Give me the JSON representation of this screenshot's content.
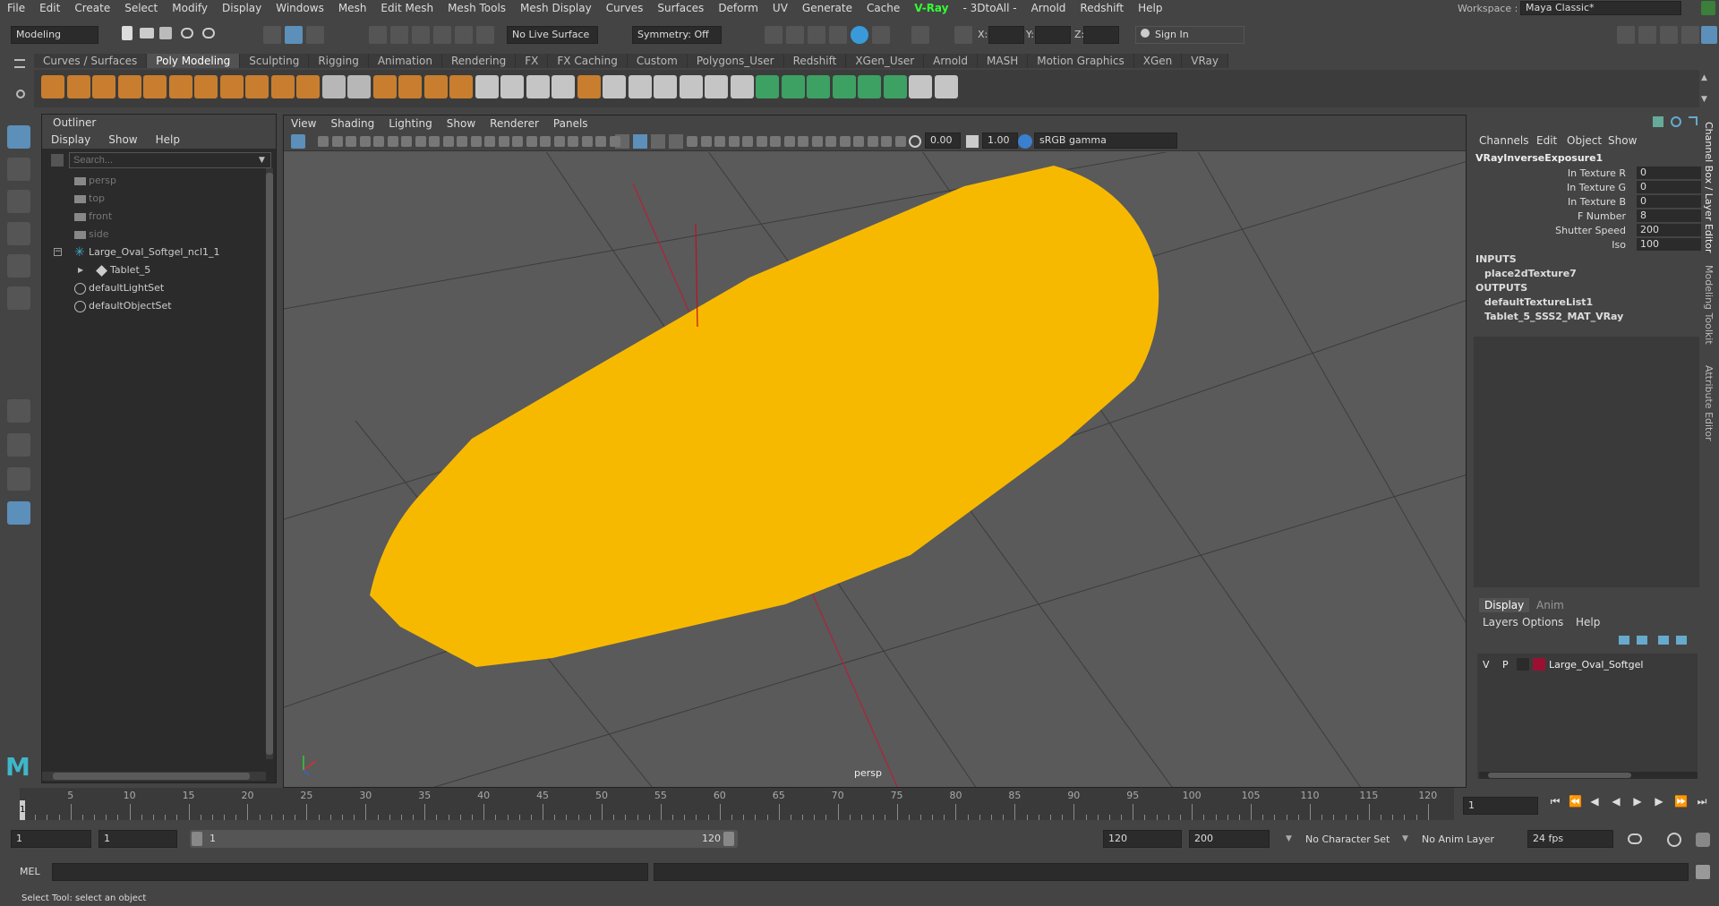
{
  "menubar": {
    "items": [
      "File",
      "Edit",
      "Create",
      "Select",
      "Modify",
      "Display",
      "Windows",
      "Mesh",
      "Edit Mesh",
      "Mesh Tools",
      "Mesh Display",
      "Curves",
      "Surfaces",
      "Deform",
      "UV",
      "Generate",
      "Cache",
      "V-Ray",
      "- 3DtoAll -",
      "Arnold",
      "Redshift",
      "Help"
    ],
    "workspace_label": "Workspace :",
    "workspace_value": "Maya Classic*"
  },
  "statusline": {
    "mode": "Modeling",
    "live_surface": "No Live Surface",
    "symmetry": "Symmetry: Off",
    "x_label": "X:",
    "y_label": "Y:",
    "z_label": "Z:",
    "sign_in": "Sign In"
  },
  "shelf": {
    "tabs": [
      "Curves / Surfaces",
      "Poly Modeling",
      "Sculpting",
      "Rigging",
      "Animation",
      "Rendering",
      "FX",
      "FX Caching",
      "Custom",
      "Polygons_User",
      "Redshift",
      "XGen_User",
      "Arnold",
      "MASH",
      "Motion Graphics",
      "XGen",
      "VRay"
    ],
    "active_tab": "Poly Modeling"
  },
  "outliner": {
    "title": "Outliner",
    "menu": [
      "Display",
      "Show",
      "Help"
    ],
    "search_placeholder": "Search...",
    "items": [
      {
        "label": "persp",
        "icon": "camera-icon",
        "indent": 0,
        "dim": true
      },
      {
        "label": "top",
        "icon": "camera-icon",
        "indent": 0,
        "dim": true
      },
      {
        "label": "front",
        "icon": "camera-icon",
        "indent": 0,
        "dim": true
      },
      {
        "label": "side",
        "icon": "camera-icon",
        "indent": 0,
        "dim": true
      },
      {
        "label": "Large_Oval_Softgel_ncl1_1",
        "icon": "group-icon",
        "indent": 0,
        "dim": false
      },
      {
        "label": "Tablet_5",
        "icon": "mesh-icon",
        "indent": 1,
        "dim": false
      },
      {
        "label": "defaultLightSet",
        "icon": "set-icon",
        "indent": 0,
        "dim": false
      },
      {
        "label": "defaultObjectSet",
        "icon": "set-icon",
        "indent": 0,
        "dim": false
      }
    ]
  },
  "viewport": {
    "menu": [
      "View",
      "Shading",
      "Lighting",
      "Show",
      "Renderer",
      "Panels"
    ],
    "exposure": "0.00",
    "gamma": "1.00",
    "color_space": "sRGB gamma",
    "camera_label": "persp",
    "object_color": "#f7b900"
  },
  "channelbox": {
    "menu": [
      "Channels",
      "Edit",
      "Object",
      "Show"
    ],
    "node": "VRayInverseExposure1",
    "attributes": [
      {
        "name": "In Texture R",
        "value": "0"
      },
      {
        "name": "In Texture G",
        "value": "0"
      },
      {
        "name": "In Texture B",
        "value": "0"
      },
      {
        "name": "F Number",
        "value": "8"
      },
      {
        "name": "Shutter Speed",
        "value": "200"
      },
      {
        "name": "Iso",
        "value": "100"
      }
    ],
    "inputs_label": "INPUTS",
    "inputs": [
      "place2dTexture7"
    ],
    "outputs_label": "OUTPUTS",
    "outputs": [
      "defaultTextureList1",
      "Tablet_5_SSS2_MAT_VRay"
    ]
  },
  "sidetabs": [
    "Channel Box / Layer Editor",
    "Modeling Toolkit",
    "Attribute Editor"
  ],
  "layers": {
    "tabs": [
      "Display",
      "Anim"
    ],
    "menu": [
      "Layers",
      "Options",
      "Help"
    ],
    "layer": {
      "v": "V",
      "p": "P",
      "name": "Large_Oval_Softgel",
      "color": "#9b1030"
    }
  },
  "timeline": {
    "ticks": [
      "5",
      "10",
      "15",
      "20",
      "25",
      "30",
      "35",
      "40",
      "45",
      "50",
      "55",
      "60",
      "65",
      "70",
      "75",
      "80",
      "85",
      "90",
      "95",
      "100",
      "105",
      "110",
      "115",
      "120"
    ],
    "current_frame": "1",
    "frame_field": "1"
  },
  "range": {
    "start": "1",
    "playback_start": "1",
    "slider_start": "1",
    "slider_end": "120",
    "playback_end": "120",
    "end": "200",
    "character_set": "No Character Set",
    "anim_layer": "No Anim Layer",
    "fps": "24 fps"
  },
  "cmdline": {
    "label": "MEL"
  },
  "helpline": {
    "text": "Select Tool: select an object"
  }
}
